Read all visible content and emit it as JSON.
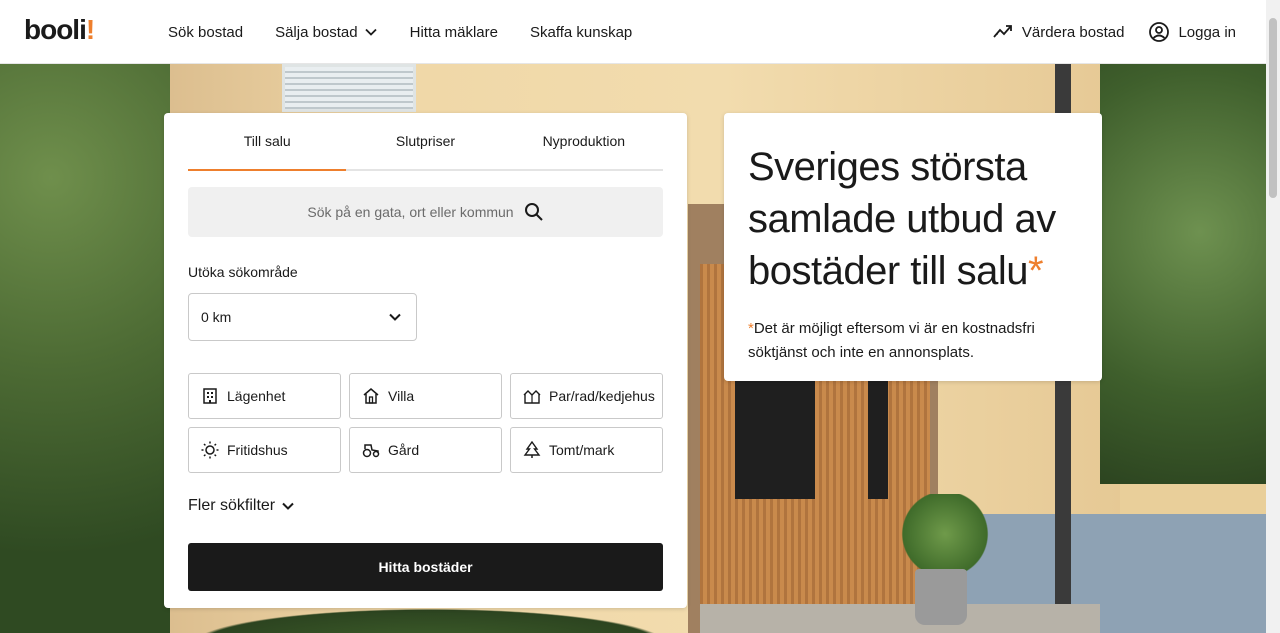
{
  "brand": {
    "logo_text": "booli",
    "logo_accent": "!",
    "accent_color": "#ee7f2d"
  },
  "nav": {
    "items": [
      {
        "label": "Sök bostad"
      },
      {
        "label": "Sälja bostad"
      },
      {
        "label": "Hitta mäklare"
      },
      {
        "label": "Skaffa kunskap"
      }
    ],
    "value_label": "Värdera bostad",
    "login_label": "Logga in"
  },
  "search": {
    "tabs": [
      {
        "label": "Till salu",
        "active": true
      },
      {
        "label": "Slutpriser",
        "active": false
      },
      {
        "label": "Nyproduktion",
        "active": false
      }
    ],
    "placeholder": "Sök på en gata, ort eller kommun",
    "expand_label": "Utöka sökområde",
    "radius_value": "0 km",
    "types": [
      {
        "label": "Lägenhet",
        "icon": "building-icon"
      },
      {
        "label": "Villa",
        "icon": "house-icon"
      },
      {
        "label": "Par/rad/kedjehus",
        "icon": "rowhouse-icon"
      },
      {
        "label": "Fritidshus",
        "icon": "sun-icon"
      },
      {
        "label": "Gård",
        "icon": "tractor-icon"
      },
      {
        "label": "Tomt/mark",
        "icon": "tree-icon"
      }
    ],
    "more_filters_label": "Fler sökfilter",
    "submit_label": "Hitta bostäder"
  },
  "hero": {
    "title_line1": "Sveriges största",
    "title_line2": "samlade utbud av",
    "title_line3": "bostäder till salu",
    "title_mark": "*",
    "footnote_mark": "*",
    "footnote": "Det är möjligt eftersom vi är en kostnadsfri söktjänst och inte en annonsplats."
  }
}
